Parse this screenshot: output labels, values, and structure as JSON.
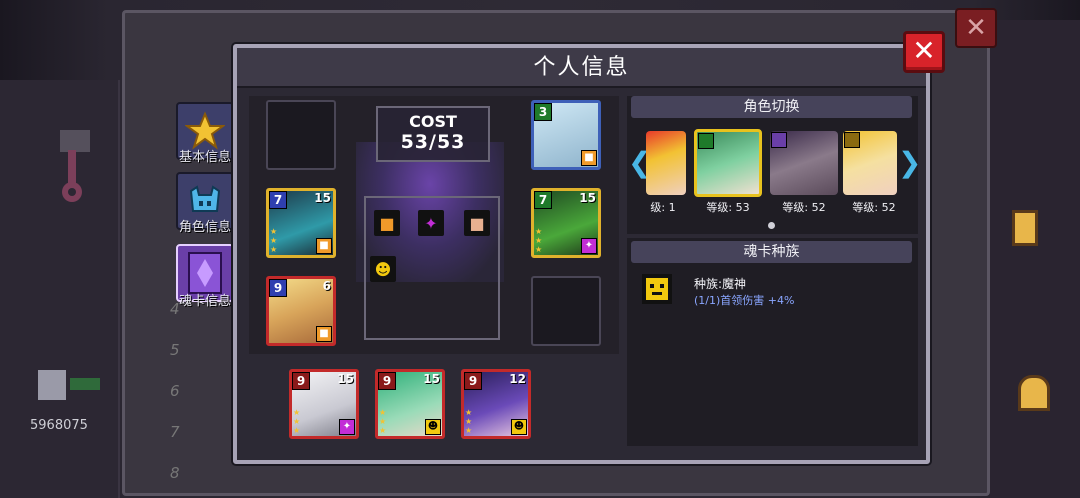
{
  "dialog": {
    "title": "个人信息",
    "close_label": "✕"
  },
  "background": {
    "close_label": "✕",
    "row_numbers": [
      "4",
      "5",
      "6",
      "7",
      "8"
    ],
    "player_score": "5968075"
  },
  "side_tabs": [
    {
      "label": "基本信息",
      "icon": "star-icon",
      "selected": false
    },
    {
      "label": "角色信息",
      "icon": "helmet-icon",
      "selected": false
    },
    {
      "label": "魂卡信息",
      "icon": "soul-crystal-icon",
      "selected": true
    }
  ],
  "deck": {
    "cost_label": "COST",
    "cost_value": "53/53",
    "race_icons": [
      "demon-orange-icon",
      "void-purple-icon",
      "human-skin-icon",
      "demon-god-yellow-icon"
    ],
    "cards": [
      {
        "name": "ice-yeti-card",
        "cost": "3",
        "power": "",
        "race": "orange",
        "frame": "blue",
        "stars": 0
      },
      {
        "name": "dark-mage-card",
        "cost": "7",
        "power": "15",
        "race": "orange",
        "frame": "gold",
        "stars": 3
      },
      {
        "name": "forest-beast-card",
        "cost": "7",
        "power": "15",
        "race": "purple",
        "frame": "gold",
        "stars": 3
      },
      {
        "name": "blonde-warrior-card",
        "cost": "9",
        "power": "6",
        "race": "orange",
        "frame": "red",
        "stars": 0
      },
      {
        "name": "white-hair-card",
        "cost": "9",
        "power": "15",
        "race": "purple",
        "frame": "red",
        "stars": 3
      },
      {
        "name": "green-hair-card",
        "cost": "9",
        "power": "15",
        "race": "yellow",
        "frame": "red",
        "stars": 3
      },
      {
        "name": "purple-hair-card",
        "cost": "9",
        "power": "12",
        "race": "yellow",
        "frame": "red",
        "stars": 3
      }
    ]
  },
  "role_switch": {
    "title": "角色切换",
    "characters": [
      {
        "label": "级: 1",
        "selected": false
      },
      {
        "label": "等级: 53",
        "selected": true
      },
      {
        "label": "等级: 52",
        "selected": false
      },
      {
        "label": "等级: 52",
        "selected": false
      }
    ],
    "left_arrow": "❮",
    "right_arrow": "❯"
  },
  "race_panel": {
    "title": "魂卡种族",
    "race_name": "种族:魔神",
    "race_bonus": "(1/1)首领伤害 +4%"
  },
  "colors": {
    "accent_red": "#d8232a",
    "cost_blue": "#2f3fb0",
    "cost_green": "#1f7a2a",
    "bonus_blue": "#8aa6ff",
    "selected_gold": "#e8c21e"
  }
}
